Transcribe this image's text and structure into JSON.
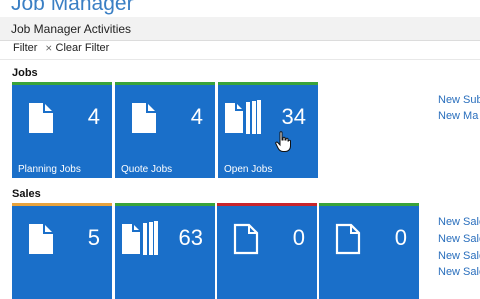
{
  "page": {
    "title": "Job Manager"
  },
  "activities": {
    "title": "Job Manager Activities"
  },
  "actions": {
    "filter": "Filter",
    "clear_filter": "Clear Filter"
  },
  "groups": {
    "jobs": {
      "label": "Jobs",
      "tiles": [
        {
          "label": "Planning Jobs",
          "count": "4",
          "icon": "single-document-icon",
          "stripe_color": "#3aa33a"
        },
        {
          "label": "Quote Jobs",
          "count": "4",
          "icon": "single-document-icon",
          "stripe_color": "#3aa33a"
        },
        {
          "label": "Open Jobs",
          "count": "34",
          "icon": "multi-document-icon",
          "stripe_color": "#3aa33a"
        }
      ]
    },
    "sales": {
      "label": "Sales",
      "tiles": [
        {
          "label": "",
          "count": "5",
          "icon": "single-document-icon",
          "stripe_color": "#e8a33d"
        },
        {
          "label": "",
          "count": "63",
          "icon": "multi-document-icon",
          "stripe_color": "#3aa33a"
        },
        {
          "label": "",
          "count": "0",
          "icon": "document-outline-icon",
          "stripe_color": "#c8252c"
        },
        {
          "label": "",
          "count": "0",
          "icon": "document-outline-icon",
          "stripe_color": "#3aa33a"
        }
      ]
    }
  },
  "links": {
    "jobs": [
      "New Sub",
      "New Ma"
    ],
    "sales": [
      "New Sale",
      "New Sale",
      "New Sale",
      "New Sale"
    ]
  },
  "colors": {
    "tile": "#1a6fc9",
    "title": "#3a7fc4",
    "link": "#2a6fbd"
  }
}
